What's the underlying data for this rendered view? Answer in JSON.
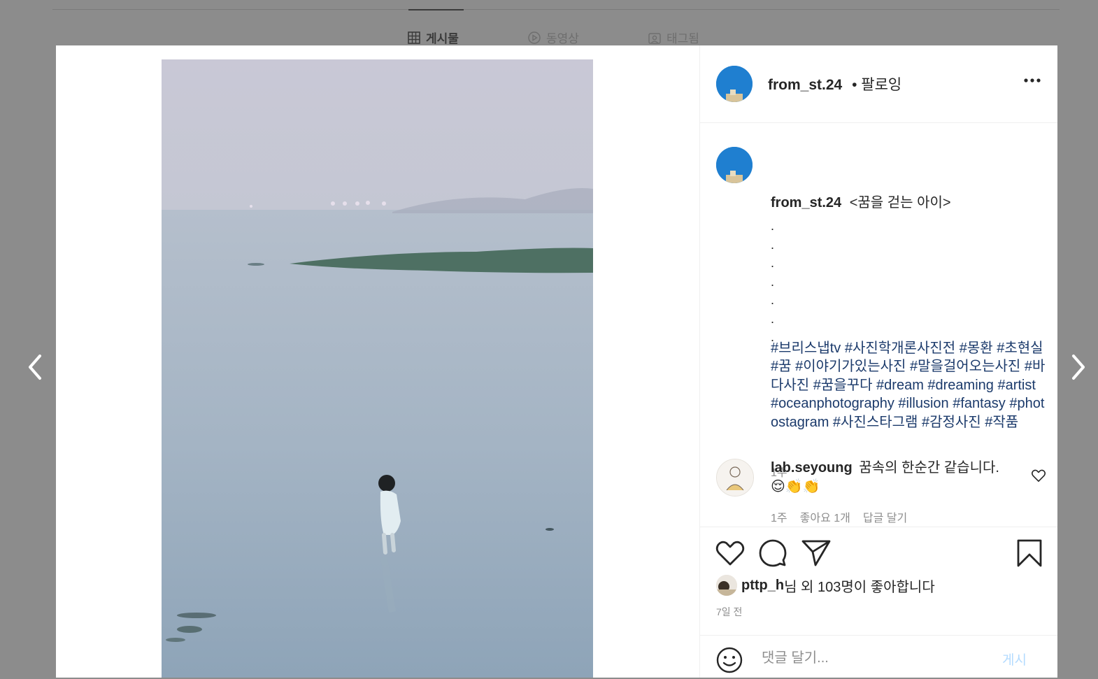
{
  "profile_tabs": [
    {
      "label": "게시물",
      "icon": "grid-icon",
      "active": true
    },
    {
      "label": "동영상",
      "icon": "play-icon",
      "active": false
    },
    {
      "label": "태그됨",
      "icon": "tag-icon",
      "active": false
    }
  ],
  "post": {
    "author": "from_st.24",
    "follow_status": "• 팔로잉",
    "caption_title": "<꿈을 걷는 아이>",
    "caption_dots": [
      ".",
      ".",
      ".",
      ".",
      ".",
      ".",
      "."
    ],
    "hashtags": "#브리스냅tv #사진학개론사진전 #몽환 #초현실 #꿈 #이야기가있는사진 #말을걸어오는사진 #바다사진 #꿈을꾸다 #dream #dreaming #artist #oceanphotography #illusion #fantasy #photostagram #사진스타그램 #감정사진 #작품",
    "caption_time": "1주"
  },
  "comments": [
    {
      "user": "lab.seyoung",
      "text": "꿈속의 한순간 같습니다.",
      "emoji": "😌👏👏",
      "time": "1주",
      "likes": "좋아요 1개",
      "reply": "답글 달기"
    }
  ],
  "likes": {
    "user": "pttp_h",
    "rest": "님 외 103명이 좋아합니다"
  },
  "post_date": "7일 전",
  "comment_box": {
    "placeholder": "댓글 달기...",
    "post_label": "게시"
  },
  "colors": {
    "hashtag": "#1b3a6b",
    "avatar": "#1f7fd0",
    "post_button_disabled": "#b3dbff"
  }
}
